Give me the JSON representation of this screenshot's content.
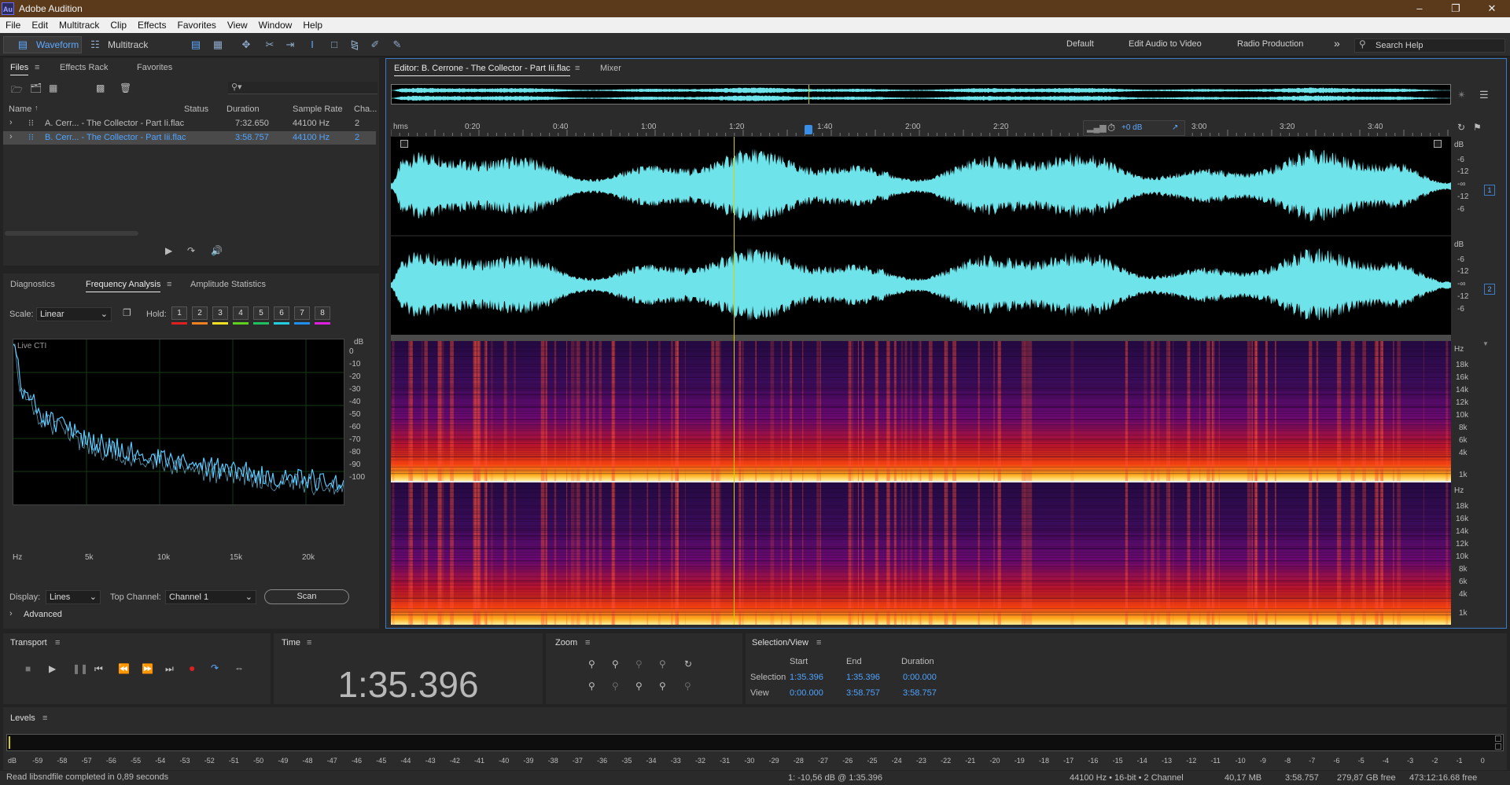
{
  "window": {
    "title": "Adobe Audition",
    "logo": "Au"
  },
  "menu": [
    "File",
    "Edit",
    "Multitrack",
    "Clip",
    "Effects",
    "Favorites",
    "View",
    "Window",
    "Help"
  ],
  "toolbar": {
    "waveform": "Waveform",
    "multitrack": "Multitrack",
    "workspaces": [
      "Default",
      "Edit Audio to Video",
      "Radio Production"
    ],
    "more": "»",
    "search_placeholder": "Search Help"
  },
  "files": {
    "tabs": [
      "Files",
      "Effects Rack",
      "Favorites"
    ],
    "columns": [
      "Name",
      "Status",
      "Duration",
      "Sample Rate",
      "Cha..."
    ],
    "rows": [
      {
        "name": "A. Cerr... - The Collector - Part Ii.flac",
        "duration": "7:32.650",
        "rate": "44100 Hz",
        "ch": "2",
        "selected": false
      },
      {
        "name": "B. Cerr... - The Collector - Part Iii.flac",
        "duration": "3:58.757",
        "rate": "44100 Hz",
        "ch": "2",
        "selected": true
      }
    ]
  },
  "analysis": {
    "tabs": [
      "Diagnostics",
      "Frequency Analysis",
      "Amplitude Statistics"
    ],
    "scale_label": "Scale:",
    "scale_value": "Linear",
    "hold_label": "Hold:",
    "hold": [
      "1",
      "2",
      "3",
      "4",
      "5",
      "6",
      "7",
      "8"
    ],
    "hold_colors": [
      "#e02020",
      "#f08020",
      "#f0e020",
      "#60d020",
      "#20c060",
      "#20d0e0",
      "#2090f0",
      "#e020e0"
    ],
    "live": "Live CTI",
    "db_title": "dB",
    "db_ticks": [
      "0",
      "-10",
      "-20",
      "-30",
      "-40",
      "-50",
      "-60",
      "-70",
      "-80",
      "-90",
      "-100"
    ],
    "hz_ticks": [
      "Hz",
      "5k",
      "10k",
      "15k",
      "20k"
    ],
    "display_label": "Display:",
    "display_value": "Lines",
    "topchan_label": "Top Channel:",
    "topchan_value": "Channel 1",
    "scan": "Scan",
    "advanced": "Advanced"
  },
  "editor": {
    "tab": "Editor: B. Cerrone - The Collector - Part Iii.flac",
    "mixer": "Mixer",
    "ruler": [
      "hms",
      "0:20",
      "0:40",
      "1:00",
      "1:20",
      "1:40",
      "2:00",
      "2:20",
      "3:00",
      "3:20",
      "3:40"
    ],
    "gain": "+0 dB",
    "db_labels": [
      "dB",
      "-6",
      "-12",
      "-∞",
      "-12",
      "-6"
    ],
    "ch_badges": [
      "1",
      "2"
    ],
    "hz_labels": [
      "Hz",
      "18k",
      "16k",
      "14k",
      "12k",
      "10k",
      "8k",
      "6k",
      "4k",
      "1k"
    ]
  },
  "transport": {
    "title": "Transport"
  },
  "time": {
    "title": "Time",
    "value": "1:35.396"
  },
  "zoom": {
    "title": "Zoom"
  },
  "selection": {
    "title": "Selection/View",
    "cols": [
      "Start",
      "End",
      "Duration"
    ],
    "selection_label": "Selection",
    "view_label": "View",
    "selection": [
      "1:35.396",
      "1:35.396",
      "0:00.000"
    ],
    "view": [
      "0:00.000",
      "3:58.757",
      "3:58.757"
    ]
  },
  "levels": {
    "title": "Levels",
    "ticks": [
      "dB",
      "-59",
      "-58",
      "-57",
      "-56",
      "-55",
      "-54",
      "-53",
      "-52",
      "-51",
      "-50",
      "-49",
      "-48",
      "-47",
      "-46",
      "-45",
      "-44",
      "-43",
      "-42",
      "-41",
      "-40",
      "-39",
      "-38",
      "-37",
      "-36",
      "-35",
      "-34",
      "-33",
      "-32",
      "-31",
      "-30",
      "-29",
      "-28",
      "-27",
      "-26",
      "-25",
      "-24",
      "-23",
      "-22",
      "-21",
      "-20",
      "-19",
      "-18",
      "-17",
      "-16",
      "-15",
      "-14",
      "-13",
      "-12",
      "-11",
      "-10",
      "-9",
      "-8",
      "-7",
      "-6",
      "-5",
      "-4",
      "-3",
      "-2",
      "-1",
      "0"
    ]
  },
  "status": {
    "left": "Read libsndfile completed in 0,89 seconds",
    "cursor": "1: -10,56 dB @ 1:35.396",
    "format": "44100 Hz • 16-bit • 2 Channel",
    "size": "40,17 MB",
    "dur": "3:58.757",
    "free": "279,87 GB free",
    "freetime": "473:12:16.68 free"
  }
}
